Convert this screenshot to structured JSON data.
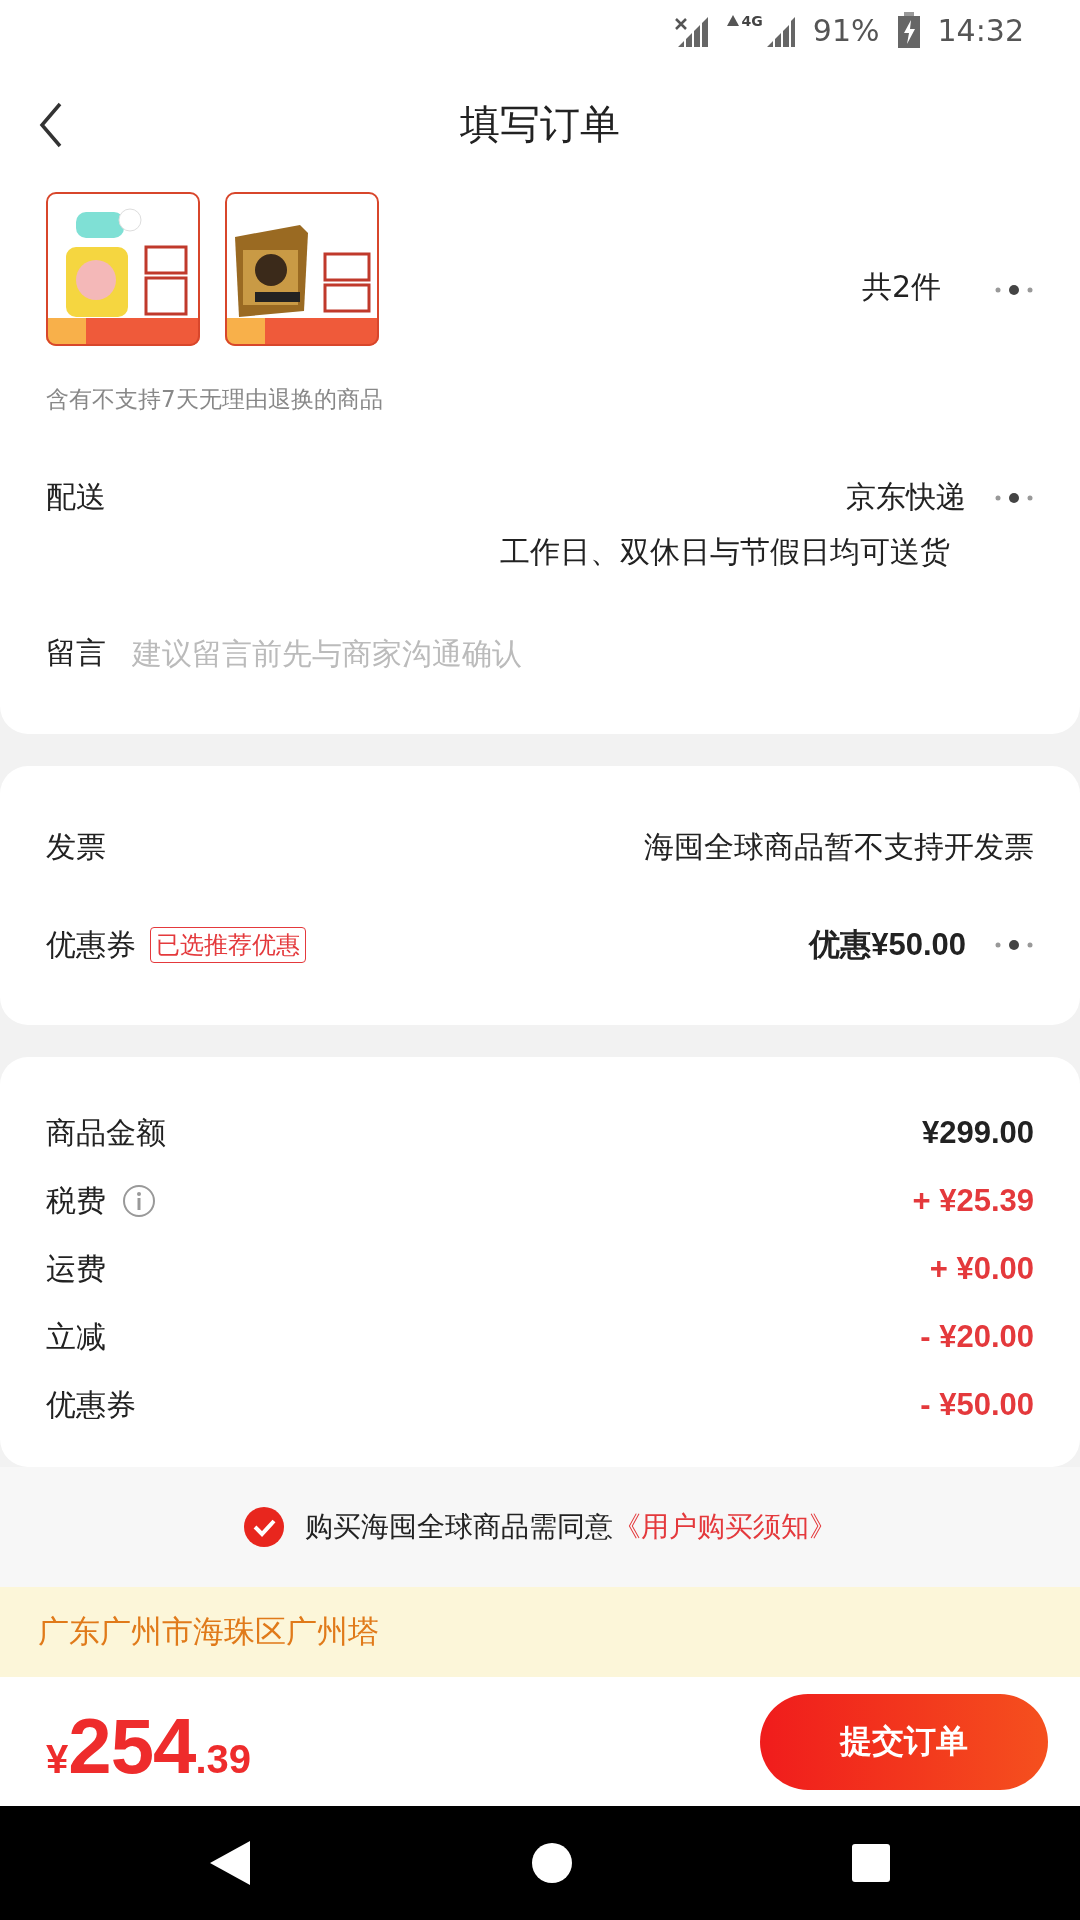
{
  "status_bar": {
    "network": "4G",
    "battery": "91%",
    "time": "14:32"
  },
  "header": {
    "title": "填写订单"
  },
  "products": {
    "count": "共2件"
  },
  "return_note": "含有不支持7天无理由退换的商品",
  "delivery": {
    "label": "配送",
    "method": "京东快递",
    "schedule": "工作日、双休日与节假日均可送货"
  },
  "message": {
    "label": "留言",
    "placeholder": "建议留言前先与商家沟通确认"
  },
  "invoice": {
    "label": "发票",
    "value": "海囤全球商品暂不支持开发票"
  },
  "coupon": {
    "label": "优惠券",
    "badge": "已选推荐优惠",
    "value": "优惠¥50.00"
  },
  "fees": [
    {
      "label": "商品金额",
      "amount": "¥299.00",
      "kind": "base",
      "info": false
    },
    {
      "label": "税费",
      "amount": "+ ¥25.39",
      "kind": "adjust",
      "info": true
    },
    {
      "label": "运费",
      "amount": "+ ¥0.00",
      "kind": "adjust",
      "info": false
    },
    {
      "label": "立减",
      "amount": "- ¥20.00",
      "kind": "adjust",
      "info": false
    },
    {
      "label": "优惠券",
      "amount": "- ¥50.00",
      "kind": "adjust",
      "info": false
    }
  ],
  "agreement": {
    "checked": true,
    "text": "购买海囤全球商品需同意",
    "link": "《用户购买须知》"
  },
  "address": "广东广州市海珠区广州塔",
  "total": {
    "currency": "¥",
    "integer": "254",
    "decimal": ".39"
  },
  "submit_button": "提交订单"
}
